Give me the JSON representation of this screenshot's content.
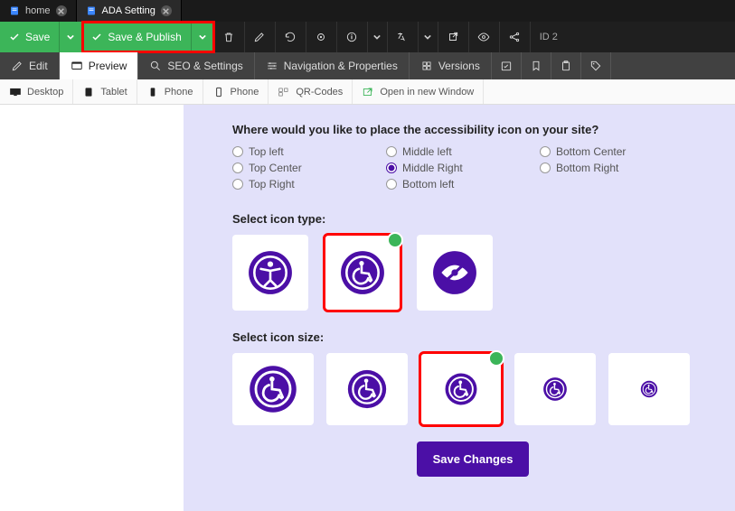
{
  "tabs": [
    {
      "label": "home"
    },
    {
      "label": "ADA Setting"
    }
  ],
  "toolbar": {
    "save_label": "Save",
    "save_publish_label": "Save & Publish",
    "id_text": "ID 2"
  },
  "sectabs": {
    "edit": "Edit",
    "preview": "Preview",
    "seo": "SEO & Settings",
    "nav": "Navigation & Properties",
    "versions": "Versions"
  },
  "devbar": {
    "desktop": "Desktop",
    "tablet": "Tablet",
    "phone1": "Phone",
    "phone2": "Phone",
    "qr": "QR-Codes",
    "open": "Open in new Window"
  },
  "content": {
    "placement_q": "Where would you like to place the accessibility icon on your site?",
    "options": {
      "tl": "Top left",
      "tc": "Top Center",
      "tr": "Top Right",
      "ml": "Middle left",
      "mr": "Middle Right",
      "bl": "Bottom left",
      "bc": "Bottom Center",
      "br": "Bottom Right"
    },
    "icon_type_label": "Select icon type:",
    "icon_size_label": "Select icon size:",
    "save_changes": "Save Changes"
  }
}
